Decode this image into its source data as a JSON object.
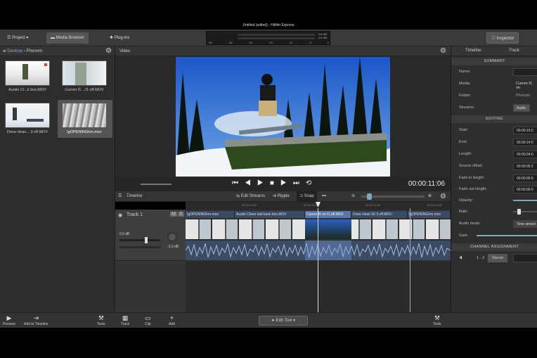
{
  "window": {
    "title": "Untitled (edited) - Hitfilm Express"
  },
  "toolbar": {
    "project_label": "Project",
    "media_browser_label": "Media Browser",
    "plugins_label": "Plug-ins",
    "inspector_label": "Inspector",
    "meter": {
      "db_top": "-3.0 dB",
      "db_bottom": "-3.0 dB",
      "scale": [
        "-60",
        "-45",
        "-30",
        "-20",
        "-12",
        "-6",
        "0"
      ]
    }
  },
  "media_browser": {
    "breadcrumb": [
      "Desktop",
      "Phenom"
    ],
    "items": [
      {
        "label": "Austin Cl...k box.MOV",
        "selected": false
      },
      {
        "label": "Curren f1 ...f1 off.MOV",
        "selected": false
      },
      {
        "label": "Drew clean... 3 off.MOV",
        "selected": false
      },
      {
        "label": "IgOPENINGhm.mov",
        "selected": true
      }
    ]
  },
  "video": {
    "title": "Video",
    "timecode": "00:00:11:06"
  },
  "timeline": {
    "title": "Timeline",
    "edit_streams_label": "Edit Streams",
    "ripple_label": "Ripple",
    "snap_label": "Snap",
    "ruler_ticks": [
      "00:00:10:00",
      "00:00:11:00",
      "00:00:12:00",
      "00:00:13:00"
    ],
    "track": {
      "name": "Track 1",
      "mute": "M",
      "solo": "S",
      "gain": "0.0 dB",
      "pan": "-3.0 dB"
    },
    "clips": [
      {
        "label": "IgOPENINGhm.mov",
        "selected": false
      },
      {
        "label": "Austin Clean laid back box.MOV",
        "selected": false
      },
      {
        "label": "Curren f1 on f1 off.MOV",
        "selected": true
      },
      {
        "label": "Drew clean 50 3 off.MOV",
        "selected": false
      },
      {
        "label": "IgOPENINGhm.mov",
        "selected": false
      }
    ]
  },
  "inspector": {
    "tabs": [
      "Timeline",
      "Track"
    ],
    "summary": {
      "header": "SUMMARY",
      "name_label": "Name:",
      "media_label": "Media:",
      "media_value": "Curren f1 on",
      "folder_label": "Folder:",
      "folder_value": "Phenom",
      "streams_label": "Streams:",
      "streams_value": "Audio"
    },
    "editing": {
      "header": "EDITING",
      "start_label": "Start:",
      "start_value": "00:00:10:0",
      "end_label": "End:",
      "end_value": "00:00:14:0",
      "length_label": "Length:",
      "length_value": "00:00:04:0",
      "source_offset_label": "Source offset:",
      "source_offset_value": "00:00:05:2",
      "fade_in_label": "Fade in length:",
      "fade_in_value": "00:00:00:0",
      "fade_out_label": "Fade out length:",
      "fade_out_value": "00:00:00:0",
      "opacity_label": "Opacity:",
      "rate_label": "Rate:",
      "audio_mode_label": "Audio mode:",
      "audio_mode_value": "Time stretch",
      "gain_label": "Gain:"
    },
    "channel": {
      "header": "CHANNEL ASSIGNMENT",
      "channels": "1 - 2",
      "mode": "Stereo"
    }
  },
  "bottombar": {
    "preview_label": "Preview",
    "add_to_timeline_label": "Add to Timeline",
    "tools_left_label": "Tools",
    "track_label": "Track",
    "clip_label": "Clip",
    "add_label": "Add",
    "edit_tool_label": "Edit Tool",
    "tools_right_label": "Tools"
  }
}
